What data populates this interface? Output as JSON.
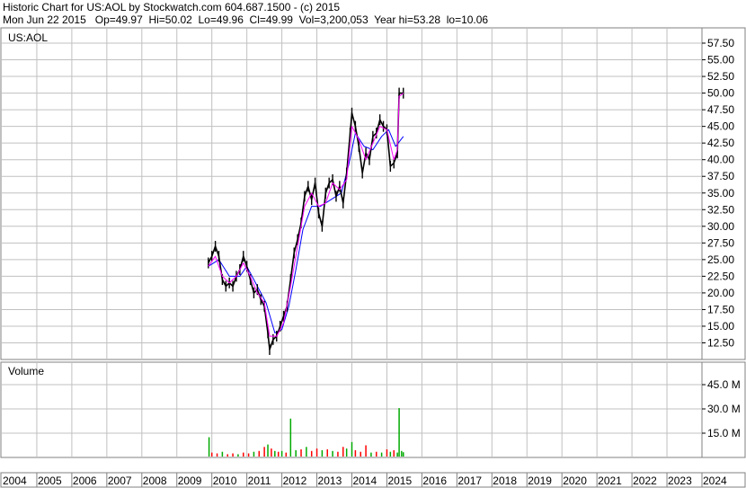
{
  "header": {
    "line1": "Historic Chart for US:AOL by Stockwatch.com 604.687.1500 - (c) 2015",
    "line2": "Mon Jun 22 2015   Op=49.97  Hi=50.02  Lo=49.96  Cl=49.99  Vol=3,200,053  Year hi=53.28  lo=10.06"
  },
  "colors": {
    "price": "#000000",
    "ma_short": "#ff00ff",
    "ma_long": "#0000ff",
    "vol_up": "#00aa00",
    "vol_down": "#ff0000",
    "grid": "#c0c0c0"
  },
  "chart_data": {
    "type": "line",
    "symbol": "US:AOL",
    "price_ylim": [
      10,
      57.5
    ],
    "price_yticks": [
      "57.50",
      "55.00",
      "52.50",
      "50.00",
      "47.50",
      "45.00",
      "42.50",
      "40.00",
      "37.50",
      "35.00",
      "32.50",
      "30.00",
      "27.50",
      "25.00",
      "22.50",
      "20.00",
      "17.50",
      "15.00",
      "12.50"
    ],
    "volume_label": "Volume",
    "volume_ylim_millions": [
      0,
      52
    ],
    "volume_yticks": [
      "45.0 M",
      "30.0 M",
      "15.0 M"
    ],
    "x_range": [
      2004,
      2024
    ],
    "years": [
      "2004",
      "2005",
      "2006",
      "2007",
      "2008",
      "2009",
      "2010",
      "2011",
      "2012",
      "2013",
      "2014",
      "2015",
      "2016",
      "2017",
      "2018",
      "2019",
      "2020",
      "2021",
      "2022",
      "2023",
      "2024"
    ],
    "price_series": [
      {
        "date": 2009.9,
        "close": 24.5
      },
      {
        "date": 2010.0,
        "close": 25.5
      },
      {
        "date": 2010.1,
        "close": 27.0
      },
      {
        "date": 2010.2,
        "close": 25.5
      },
      {
        "date": 2010.3,
        "close": 22.0
      },
      {
        "date": 2010.4,
        "close": 21.0
      },
      {
        "date": 2010.5,
        "close": 21.5
      },
      {
        "date": 2010.6,
        "close": 21.0
      },
      {
        "date": 2010.7,
        "close": 22.5
      },
      {
        "date": 2010.8,
        "close": 23.5
      },
      {
        "date": 2010.9,
        "close": 25.5
      },
      {
        "date": 2011.0,
        "close": 24.0
      },
      {
        "date": 2011.1,
        "close": 22.0
      },
      {
        "date": 2011.2,
        "close": 20.0
      },
      {
        "date": 2011.3,
        "close": 20.5
      },
      {
        "date": 2011.4,
        "close": 19.0
      },
      {
        "date": 2011.5,
        "close": 18.0
      },
      {
        "date": 2011.6,
        "close": 14.0
      },
      {
        "date": 2011.65,
        "close": 11.5
      },
      {
        "date": 2011.75,
        "close": 13.0
      },
      {
        "date": 2011.85,
        "close": 13.5
      },
      {
        "date": 2011.95,
        "close": 15.0
      },
      {
        "date": 2012.05,
        "close": 16.5
      },
      {
        "date": 2012.15,
        "close": 18.0
      },
      {
        "date": 2012.25,
        "close": 22.0
      },
      {
        "date": 2012.35,
        "close": 26.0
      },
      {
        "date": 2012.45,
        "close": 28.0
      },
      {
        "date": 2012.55,
        "close": 30.5
      },
      {
        "date": 2012.65,
        "close": 34.5
      },
      {
        "date": 2012.75,
        "close": 36.0
      },
      {
        "date": 2012.85,
        "close": 34.0
      },
      {
        "date": 2012.95,
        "close": 36.5
      },
      {
        "date": 2013.05,
        "close": 32.0
      },
      {
        "date": 2013.15,
        "close": 30.0
      },
      {
        "date": 2013.25,
        "close": 35.0
      },
      {
        "date": 2013.35,
        "close": 36.5
      },
      {
        "date": 2013.45,
        "close": 37.0
      },
      {
        "date": 2013.55,
        "close": 34.5
      },
      {
        "date": 2013.65,
        "close": 36.0
      },
      {
        "date": 2013.75,
        "close": 33.5
      },
      {
        "date": 2013.85,
        "close": 38.0
      },
      {
        "date": 2013.95,
        "close": 44.0
      },
      {
        "date": 2014.0,
        "close": 47.0
      },
      {
        "date": 2014.1,
        "close": 45.0
      },
      {
        "date": 2014.2,
        "close": 42.0
      },
      {
        "date": 2014.3,
        "close": 38.0
      },
      {
        "date": 2014.4,
        "close": 41.0
      },
      {
        "date": 2014.5,
        "close": 40.0
      },
      {
        "date": 2014.6,
        "close": 43.5
      },
      {
        "date": 2014.7,
        "close": 44.0
      },
      {
        "date": 2014.8,
        "close": 46.0
      },
      {
        "date": 2014.9,
        "close": 45.0
      },
      {
        "date": 2015.0,
        "close": 44.5
      },
      {
        "date": 2015.1,
        "close": 39.0
      },
      {
        "date": 2015.2,
        "close": 39.5
      },
      {
        "date": 2015.3,
        "close": 41.0
      },
      {
        "date": 2015.35,
        "close": 50.0
      },
      {
        "date": 2015.47,
        "close": 49.99
      }
    ],
    "ma_short_series": [
      {
        "date": 2009.9,
        "value": 24.0
      },
      {
        "date": 2010.1,
        "value": 25.5
      },
      {
        "date": 2010.3,
        "value": 22.5
      },
      {
        "date": 2010.5,
        "value": 21.5
      },
      {
        "date": 2010.7,
        "value": 22.5
      },
      {
        "date": 2010.9,
        "value": 24.5
      },
      {
        "date": 2011.1,
        "value": 22.5
      },
      {
        "date": 2011.3,
        "value": 20.0
      },
      {
        "date": 2011.5,
        "value": 18.5
      },
      {
        "date": 2011.65,
        "value": 13.5
      },
      {
        "date": 2011.85,
        "value": 13.5
      },
      {
        "date": 2012.05,
        "value": 15.5
      },
      {
        "date": 2012.25,
        "value": 21.0
      },
      {
        "date": 2012.45,
        "value": 27.0
      },
      {
        "date": 2012.65,
        "value": 33.0
      },
      {
        "date": 2012.85,
        "value": 35.0
      },
      {
        "date": 2013.05,
        "value": 33.0
      },
      {
        "date": 2013.25,
        "value": 33.5
      },
      {
        "date": 2013.45,
        "value": 36.5
      },
      {
        "date": 2013.65,
        "value": 35.5
      },
      {
        "date": 2013.85,
        "value": 37.0
      },
      {
        "date": 2014.0,
        "value": 45.0
      },
      {
        "date": 2014.2,
        "value": 43.0
      },
      {
        "date": 2014.4,
        "value": 40.0
      },
      {
        "date": 2014.6,
        "value": 42.5
      },
      {
        "date": 2014.8,
        "value": 45.0
      },
      {
        "date": 2015.0,
        "value": 44.5
      },
      {
        "date": 2015.2,
        "value": 40.0
      },
      {
        "date": 2015.3,
        "value": 41.5
      },
      {
        "date": 2015.35,
        "value": 49.5
      },
      {
        "date": 2015.47,
        "value": 50.0
      }
    ],
    "ma_long_series": [
      {
        "date": 2009.9,
        "value": 24.0
      },
      {
        "date": 2010.2,
        "value": 25.0
      },
      {
        "date": 2010.5,
        "value": 22.5
      },
      {
        "date": 2010.8,
        "value": 22.5
      },
      {
        "date": 2011.0,
        "value": 24.0
      },
      {
        "date": 2011.3,
        "value": 21.0
      },
      {
        "date": 2011.55,
        "value": 18.5
      },
      {
        "date": 2011.8,
        "value": 14.0
      },
      {
        "date": 2012.0,
        "value": 14.5
      },
      {
        "date": 2012.2,
        "value": 18.0
      },
      {
        "date": 2012.4,
        "value": 23.5
      },
      {
        "date": 2012.6,
        "value": 29.5
      },
      {
        "date": 2012.85,
        "value": 33.0
      },
      {
        "date": 2013.1,
        "value": 33.0
      },
      {
        "date": 2013.4,
        "value": 34.0
      },
      {
        "date": 2013.7,
        "value": 35.0
      },
      {
        "date": 2013.9,
        "value": 39.0
      },
      {
        "date": 2014.1,
        "value": 44.0
      },
      {
        "date": 2014.35,
        "value": 42.0
      },
      {
        "date": 2014.6,
        "value": 41.5
      },
      {
        "date": 2014.85,
        "value": 43.5
      },
      {
        "date": 2015.05,
        "value": 44.5
      },
      {
        "date": 2015.25,
        "value": 42.0
      },
      {
        "date": 2015.47,
        "value": 43.5
      }
    ],
    "volume_series_millions": [
      {
        "date": 2009.92,
        "value": 12.5,
        "up": true
      },
      {
        "date": 2010.0,
        "value": 3.0,
        "up": false
      },
      {
        "date": 2010.15,
        "value": 2.5,
        "up": false
      },
      {
        "date": 2010.3,
        "value": 3.5,
        "up": true
      },
      {
        "date": 2010.45,
        "value": 2.0,
        "up": false
      },
      {
        "date": 2010.6,
        "value": 2.5,
        "up": false
      },
      {
        "date": 2010.75,
        "value": 2.0,
        "up": true
      },
      {
        "date": 2010.9,
        "value": 3.0,
        "up": false
      },
      {
        "date": 2011.05,
        "value": 2.5,
        "up": false
      },
      {
        "date": 2011.2,
        "value": 3.5,
        "up": true
      },
      {
        "date": 2011.35,
        "value": 4.0,
        "up": false
      },
      {
        "date": 2011.5,
        "value": 6.5,
        "up": false
      },
      {
        "date": 2011.6,
        "value": 8.0,
        "up": true
      },
      {
        "date": 2011.7,
        "value": 5.5,
        "up": false
      },
      {
        "date": 2011.8,
        "value": 4.0,
        "up": true
      },
      {
        "date": 2011.9,
        "value": 3.5,
        "up": false
      },
      {
        "date": 2012.0,
        "value": 4.0,
        "up": true
      },
      {
        "date": 2012.12,
        "value": 3.0,
        "up": false
      },
      {
        "date": 2012.25,
        "value": 24.0,
        "up": true
      },
      {
        "date": 2012.4,
        "value": 4.5,
        "up": true
      },
      {
        "date": 2012.55,
        "value": 5.0,
        "up": false
      },
      {
        "date": 2012.7,
        "value": 6.5,
        "up": true
      },
      {
        "date": 2012.85,
        "value": 4.0,
        "up": false
      },
      {
        "date": 2013.0,
        "value": 5.5,
        "up": false
      },
      {
        "date": 2013.15,
        "value": 4.5,
        "up": true
      },
      {
        "date": 2013.3,
        "value": 5.0,
        "up": false
      },
      {
        "date": 2013.45,
        "value": 4.0,
        "up": true
      },
      {
        "date": 2013.6,
        "value": 3.5,
        "up": false
      },
      {
        "date": 2013.75,
        "value": 6.5,
        "up": false
      },
      {
        "date": 2013.85,
        "value": 5.5,
        "up": true
      },
      {
        "date": 2014.0,
        "value": 9.5,
        "up": true
      },
      {
        "date": 2014.1,
        "value": 4.5,
        "up": false
      },
      {
        "date": 2014.25,
        "value": 3.5,
        "up": false
      },
      {
        "date": 2014.4,
        "value": 7.5,
        "up": false
      },
      {
        "date": 2014.55,
        "value": 3.0,
        "up": true
      },
      {
        "date": 2014.7,
        "value": 3.5,
        "up": false
      },
      {
        "date": 2014.85,
        "value": 3.0,
        "up": true
      },
      {
        "date": 2015.0,
        "value": 5.0,
        "up": false
      },
      {
        "date": 2015.1,
        "value": 3.5,
        "up": true
      },
      {
        "date": 2015.2,
        "value": 4.5,
        "up": false
      },
      {
        "date": 2015.3,
        "value": 3.0,
        "up": true
      },
      {
        "date": 2015.35,
        "value": 30.5,
        "up": true
      },
      {
        "date": 2015.42,
        "value": 4.0,
        "up": true
      },
      {
        "date": 2015.47,
        "value": 3.2,
        "up": true
      }
    ]
  }
}
